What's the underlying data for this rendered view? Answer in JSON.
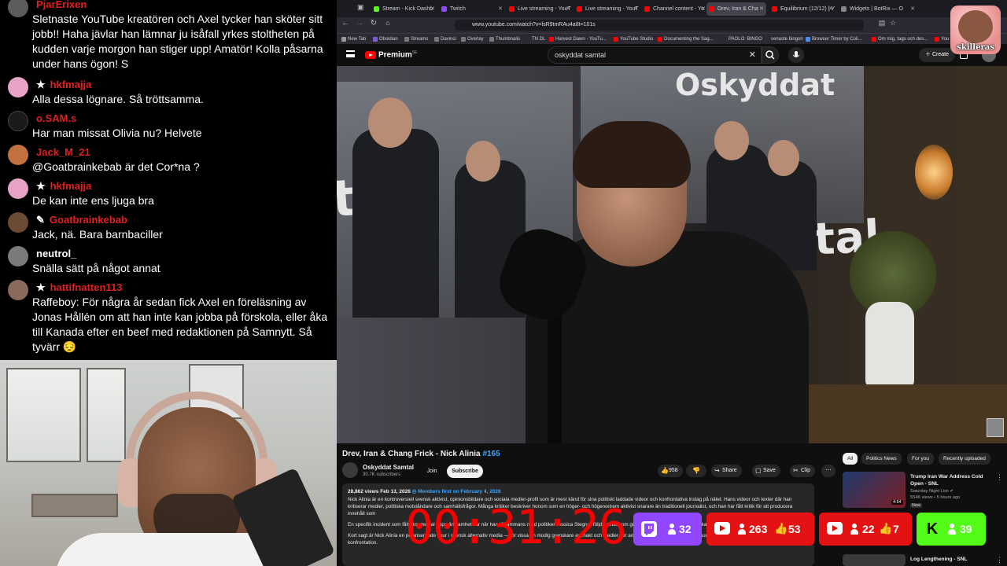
{
  "chat": {
    "messages": [
      {
        "user": "PjarErixen",
        "badge": "",
        "user_color": "#e02020",
        "lines": "Sletnaste YouTube kreatören och Axel tycker han sköter sitt jobb!! Haha jävlar han lämnar ju isåfall yrkes stoltheten på kudden varje morgon han stiger upp! Amatör! Kolla påsarna under hans ögon! S"
      },
      {
        "user": "hkfmajja",
        "badge": "★",
        "user_color": "#e02020",
        "lines": "Alla dessa lögnare. Så tröttsamma."
      },
      {
        "user": "o.SAM.s",
        "badge": "",
        "user_color": "#e02020",
        "lines": "Har man missat Olivia nu? Helvete"
      },
      {
        "user": "Jack_M_21",
        "badge": "",
        "user_color": "#e02020",
        "lines": "@Goatbrainkebab är det Cor*na ?"
      },
      {
        "user": "hkfmajja",
        "badge": "★",
        "user_color": "#e02020",
        "lines": "De kan inte ens ljuga bra"
      },
      {
        "user": "Goatbrainkebab",
        "badge": "✎",
        "user_color": "#e02020",
        "lines": "Jack, nä. Bara barnbaciller"
      },
      {
        "user": "neutrol_",
        "badge": "",
        "user_color": "#ffffff",
        "lines": "Snälla sätt på något annat"
      },
      {
        "user": "hattifnatten113",
        "badge": "★",
        "user_color": "#e02020",
        "lines": "Raffeboy: För några år sedan fick Axel en föreläsning av Jonas Hållén om att han inte kan jobba på förskola, eller åka till Kanada efter en beef med redaktionen på Samnytt. Så tyvärr 😔"
      }
    ]
  },
  "browser": {
    "tabs": [
      {
        "label": "Stream - Kick Dashb",
        "color": "#53fc18"
      },
      {
        "label": "Twitch",
        "color": "#9146ff"
      },
      {
        "label": "Live streaming - YouT",
        "color": "#ff0000"
      },
      {
        "label": "Live streaming - YouT",
        "color": "#ff0000"
      },
      {
        "label": "Channel content - Yo",
        "color": "#ff0000"
      },
      {
        "label": "Drev, Iran & Cha",
        "color": "#ff0000"
      },
      {
        "label": "Equilibrium (12/12) | Y",
        "color": "#ff0000"
      },
      {
        "label": "Widgets | BotRix — O",
        "color": "#888888"
      }
    ],
    "url": "www.youtube.com/watch?v=lsR9tmRAu4a8t=101s",
    "bookmarks": [
      "New Tab",
      "Obsidian",
      "Streams",
      "Davinci",
      "Overlay",
      "Thumbnails",
      "TN DL",
      "Harvest Dawn - YouTu...",
      "YouTube Studio",
      "Documenting the Sag...",
      "PAOLO: BINGO",
      "senaste bingon",
      "Browser Timer by Coli...",
      "Om mig, tags och des...",
      "You"
    ]
  },
  "youtube": {
    "brand": "Premium",
    "brand_sup": "SE",
    "search_value": "oskyddat samtal",
    "create_label": "Create",
    "banner_top": "Oskyddat",
    "banner_left": "tal",
    "banner_right": "Samtal",
    "video_title": "Drev, Iran & Chang Frick - Nick Alinia",
    "video_tag": "#165",
    "channel_name": "Oskyddat Samtal",
    "channel_subs": "30.7K subscribers",
    "join_label": "Join",
    "subscribe_label": "Subscribe",
    "likes": "958",
    "share_label": "Share",
    "save_label": "Save",
    "clip_label": "Clip",
    "desc_meta": "28,862 views  Feb 13, 2026",
    "desc_members": "Members first on February 4, 2026",
    "desc_body_1": "Nick Alinia är en kontroversiell svensk aktivist, opinionsbildare och sociala medier-profil som är mest känd för sina politiskt laddade videor och konfrontativa inslag på nätet. Hans videor och texter där han kritiserar medier, politiska motståndare och samhällsfrågor. Många kritiker beskriver honom som en höger- och högerextrem aktivist snarare än traditionell journalist, och han har fått kritik för att producera innehåll som",
    "desc_body_2": "En specifik incident som fått stor medial uppmärksamhet var när han tillsammans med politiker Jessica Stegrud följde debatt om gränserna för aktivism och påverkan.",
    "desc_body_3": "Kort sagt är Nick Alinia en polariserande figur i svensk alternativ media — för vissa en modig granskare av makt och medier, för andra en provokativ aktivist som suddar ut gränserna mellan opinionsbildning och konfrontation.",
    "chips": [
      "All",
      "Politics News",
      "For you",
      "Recently uploaded"
    ],
    "recs": [
      {
        "title": "Trump Iran War Address Cold Open - SNL",
        "channel": "Saturday Night Live",
        "views": "554K views • 5 hours ago",
        "duration": "4:54",
        "new": "New"
      },
      {
        "title": "Log Lengthening - SNL",
        "channel": "",
        "views": "",
        "duration": "",
        "new": ""
      }
    ]
  },
  "overlay": {
    "skilleras": "skilleras",
    "timer": "00:31:26",
    "viewers": [
      {
        "platform": "twitch",
        "viewers": "32",
        "likes": "",
        "color": "#9146ff"
      },
      {
        "platform": "youtube",
        "viewers": "263",
        "likes": "53",
        "color": "#e41212"
      },
      {
        "platform": "youtube",
        "viewers": "22",
        "likes": "7",
        "color": "#e41212"
      },
      {
        "platform": "kick",
        "viewers": "39",
        "likes": "",
        "color": "#53fc18"
      }
    ]
  }
}
